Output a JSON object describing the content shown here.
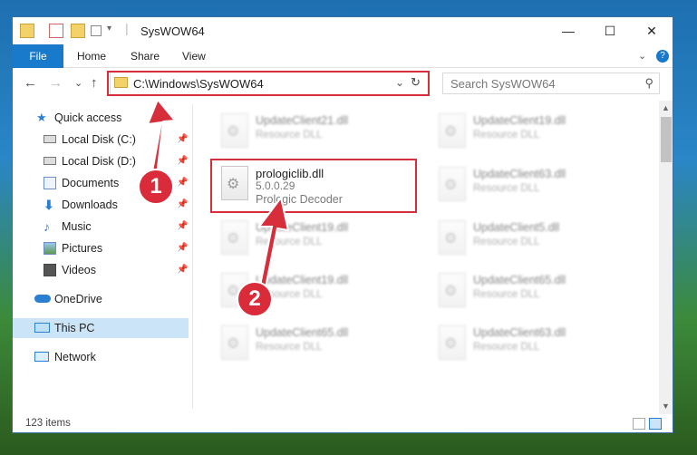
{
  "window": {
    "title": "SysWOW64",
    "minimize": "—",
    "maximize": "☐",
    "close": "✕"
  },
  "ribbon": {
    "tabs": [
      "File",
      "Home",
      "Share",
      "View"
    ],
    "collapse_glyph": "⌄",
    "help_glyph": "?"
  },
  "navbar": {
    "back": "←",
    "forward": "→",
    "recent": "⌄",
    "up": "↑",
    "address": "C:\\Windows\\SysWOW64",
    "dropdown": "⌄",
    "refresh": "↻",
    "search_placeholder": "Search SysWOW64",
    "search_glyph": "⚲"
  },
  "sidebar": {
    "items": [
      {
        "label": "Quick access",
        "icon": "star-icon",
        "pinned": false
      },
      {
        "label": "Local Disk (C:)",
        "icon": "drive-icon",
        "pinned": true
      },
      {
        "label": "Local Disk (D:)",
        "icon": "drive-icon",
        "pinned": true
      },
      {
        "label": "Documents",
        "icon": "documents-icon",
        "pinned": true
      },
      {
        "label": "Downloads",
        "icon": "download-icon",
        "pinned": true
      },
      {
        "label": "Music",
        "icon": "music-icon",
        "pinned": true
      },
      {
        "label": "Pictures",
        "icon": "pictures-icon",
        "pinned": true
      },
      {
        "label": "Videos",
        "icon": "videos-icon",
        "pinned": true
      },
      {
        "label": "OneDrive",
        "icon": "onedrive-icon",
        "pinned": false
      },
      {
        "label": "This PC",
        "icon": "pc-icon",
        "pinned": false,
        "selected": true
      },
      {
        "label": "Network",
        "icon": "network-icon",
        "pinned": false
      }
    ],
    "pin_glyph": "📌"
  },
  "files": {
    "left": [
      {
        "name": "UpdateClient21.dll",
        "desc": "Resource DLL"
      },
      {
        "name": "UpdateClient19.dll",
        "desc": "Resource DLL"
      },
      {
        "name": "UpdateClient19.dll",
        "desc": "Resource DLL"
      },
      {
        "name": "UpdateClient65.dll",
        "desc": "Resource DLL"
      }
    ],
    "right": [
      {
        "name": "UpdateClient19.dll",
        "desc": "Resource DLL"
      },
      {
        "name": "UpdateClient63.dll",
        "desc": "Resource DLL"
      },
      {
        "name": "UpdateClient5.dll",
        "desc": "Resource DLL"
      },
      {
        "name": "UpdateClient65.dll",
        "desc": "Resource DLL"
      },
      {
        "name": "UpdateClient63.dll",
        "desc": "Resource DLL"
      }
    ],
    "highlighted": {
      "name": "prologiclib.dll",
      "version": "5.0.0.29",
      "desc": "Prologic Decoder"
    }
  },
  "status": {
    "items_count": "123 items"
  },
  "annotations": {
    "step1": "1",
    "step2": "2",
    "accent": "#d62e3a"
  }
}
